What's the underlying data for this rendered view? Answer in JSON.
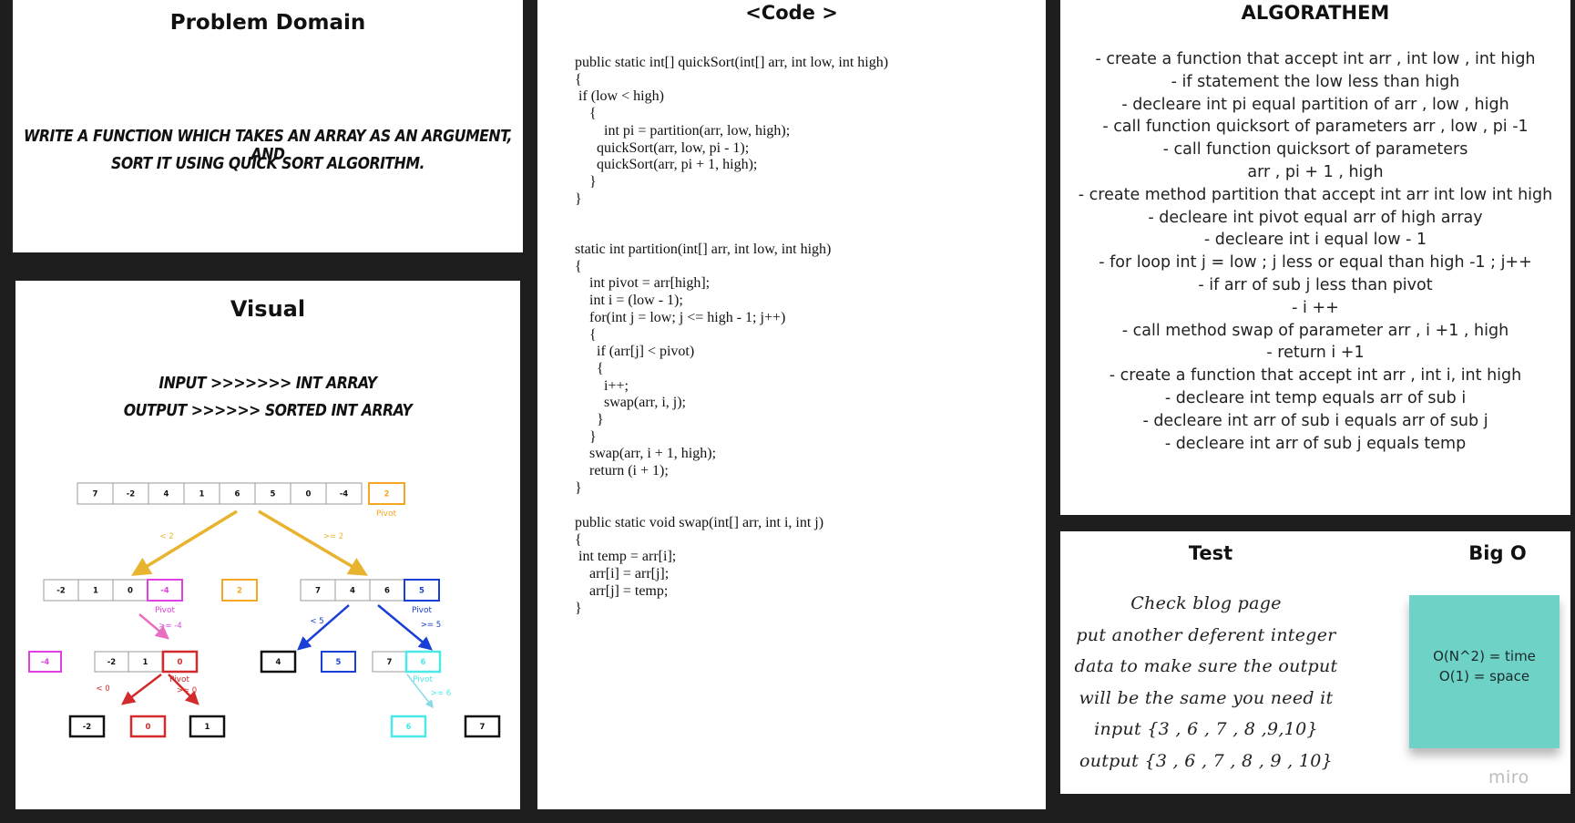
{
  "problem_domain": {
    "title": "Problem Domain",
    "line1": "WRITE A FUNCTION WHICH TAKES AN ARRAY AS AN ARGUMENT, AND",
    "line2": "SORT IT USING QUICK SORT ALGORITHM."
  },
  "visual": {
    "title": "Visual",
    "input_line": "INPUT >>>>>>> INT ARRAY",
    "output_line": "OUTPUT >>>>>> SORTED INT ARRAY",
    "diagram": {
      "initial_array": [
        "7",
        "-2",
        "4",
        "1",
        "6",
        "5",
        "0",
        "-4"
      ],
      "initial_pivot": "2",
      "pivot_label": "Pivot",
      "left_edge_label": "< 2",
      "right_edge_label": ">= 2",
      "left_sub_array": [
        "-2",
        "1",
        "0"
      ],
      "left_sub_pivot": "-4",
      "middle_pivot": "2",
      "right_sub_array": [
        "7",
        "4",
        "6"
      ],
      "right_sub_pivot": "5",
      "edge_ge_neg4": ">= -4",
      "edge_lt_5": "< 5",
      "edge_ge_5": ">= 5",
      "level3_neg4": "-4",
      "level3_left_array": [
        "-2",
        "1"
      ],
      "level3_left_pivot": "0",
      "level3_four": "4",
      "level3_five": "5",
      "level3_right_array": [
        "7"
      ],
      "level3_right_pivot": "6",
      "edge_lt_0": "< 0",
      "edge_ge_0": ">= 0",
      "edge_ge_6": ">= 6",
      "leaf_neg2": "-2",
      "leaf_zero": "0",
      "leaf_one": "1",
      "leaf_six": "6",
      "leaf_seven": "7"
    }
  },
  "code": {
    "title": "<Code >",
    "block1": "public static int[] quickSort(int[] arr, int low, int high)\n{\n if (low < high)\n    {\n        int pi = partition(arr, low, high);\n      quickSort(arr, low, pi - 1);\n      quickSort(arr, pi + 1, high);\n    }\n}",
    "block2": "static int partition(int[] arr, int low, int high)\n{\n    int pivot = arr[high];\n    int i = (low - 1);\n    for(int j = low; j <= high - 1; j++)\n    {\n      if (arr[j] < pivot)\n      {\n        i++;\n        swap(arr, i, j);\n      }\n    }\n    swap(arr, i + 1, high);\n    return (i + 1);\n}",
    "block3": "public static void swap(int[] arr, int i, int j)\n{\n int temp = arr[i];\n    arr[i] = arr[j];\n    arr[j] = temp;\n}"
  },
  "algorithm": {
    "title": "ALGORATHEM",
    "lines": [
      "- create a function that accept int arr , int low , int high",
      "- if statement the low less than high",
      "- decleare int pi equal partition of arr , low , high",
      "- call function quicksort of parameters arr , low , pi -1",
      "- call function quicksort of parameters",
      "arr , pi + 1 , high",
      "- create method partition that accept int arr int low int high",
      "- decleare int pivot equal arr of high array",
      "- decleare int i equal low - 1",
      "- for loop int j = low ; j less or equal than high -1 ; j++",
      "- if arr of sub  j less than pivot",
      "- i ++",
      "- call method swap of parameter arr , i +1 , high",
      "- return i +1",
      "- create a function that accept int arr , int i, int high",
      "- decleare int temp equals arr of sub i",
      "- decleare int arr of sub i equals arr of sub j",
      "- decleare int arr of sub j equals temp"
    ]
  },
  "test": {
    "title": "Test",
    "lines": [
      "Check blog page",
      "put another deferent integer",
      "data to make sure the output",
      "will be the same you need it",
      "input {3 , 6 , 7 , 8 ,9,10}",
      "output {3 , 6 , 7 , 8 , 9 , 10}"
    ]
  },
  "big_o": {
    "title": "Big O",
    "time": "O(N^2) = time",
    "space": "O(1) = space"
  },
  "watermark": "miro",
  "colors": {
    "background": "#1e1e1e",
    "pivot_orange": "#f5a623",
    "gold_arrow": "#e8b430",
    "magenta": "#e040e0",
    "pink_arrow": "#e870c0",
    "blue": "#1a3fd6",
    "red": "#d32b2b",
    "cyan": "#4de8e8",
    "sticky_note": "#6ed2c6"
  }
}
